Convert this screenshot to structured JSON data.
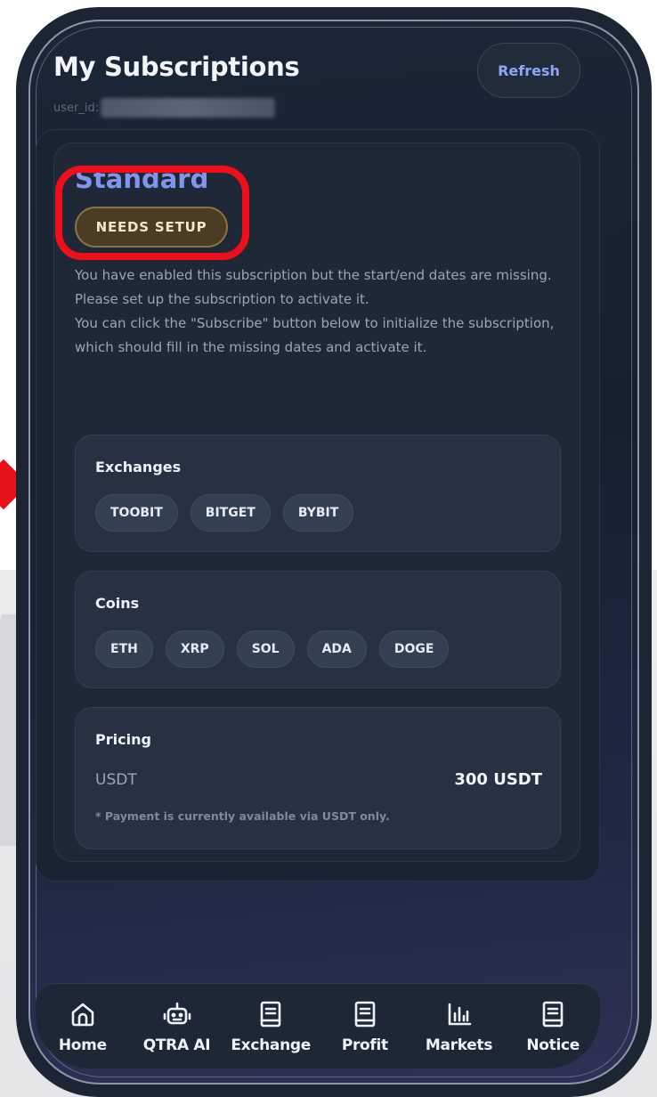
{
  "header": {
    "title": "My Subscriptions",
    "user_id_label": "user_id:",
    "refresh_label": "Refresh"
  },
  "subscription": {
    "plan_name": "Standard",
    "status_badge": "NEEDS SETUP",
    "description_1": "You have enabled this subscription but the start/end dates are missing. Please set up the subscription to activate it.",
    "description_2": "You can click the \"Subscribe\" button below to initialize the subscription, which should fill in the missing dates and activate it.",
    "exchanges": {
      "title": "Exchanges",
      "items": [
        "TOOBIT",
        "BITGET",
        "BYBIT"
      ]
    },
    "coins": {
      "title": "Coins",
      "items": [
        "ETH",
        "XRP",
        "SOL",
        "ADA",
        "DOGE"
      ]
    },
    "pricing": {
      "title": "Pricing",
      "currency_label": "USDT",
      "price": "300 USDT",
      "note": "* Payment is currently available via USDT only."
    }
  },
  "nav": {
    "items": [
      {
        "label": "Home",
        "icon": "home-icon"
      },
      {
        "label": "QTRA AI",
        "icon": "robot-icon"
      },
      {
        "label": "Exchange",
        "icon": "document-icon"
      },
      {
        "label": "Profit",
        "icon": "document-icon"
      },
      {
        "label": "Markets",
        "icon": "bar-chart-icon"
      },
      {
        "label": "Notice",
        "icon": "document-icon"
      }
    ]
  },
  "colors": {
    "accent": "#8fa4ff",
    "plan_name": "#7f95ee",
    "badge_bg": "#4a3d24",
    "annotation_red": "#ee0f1b"
  }
}
